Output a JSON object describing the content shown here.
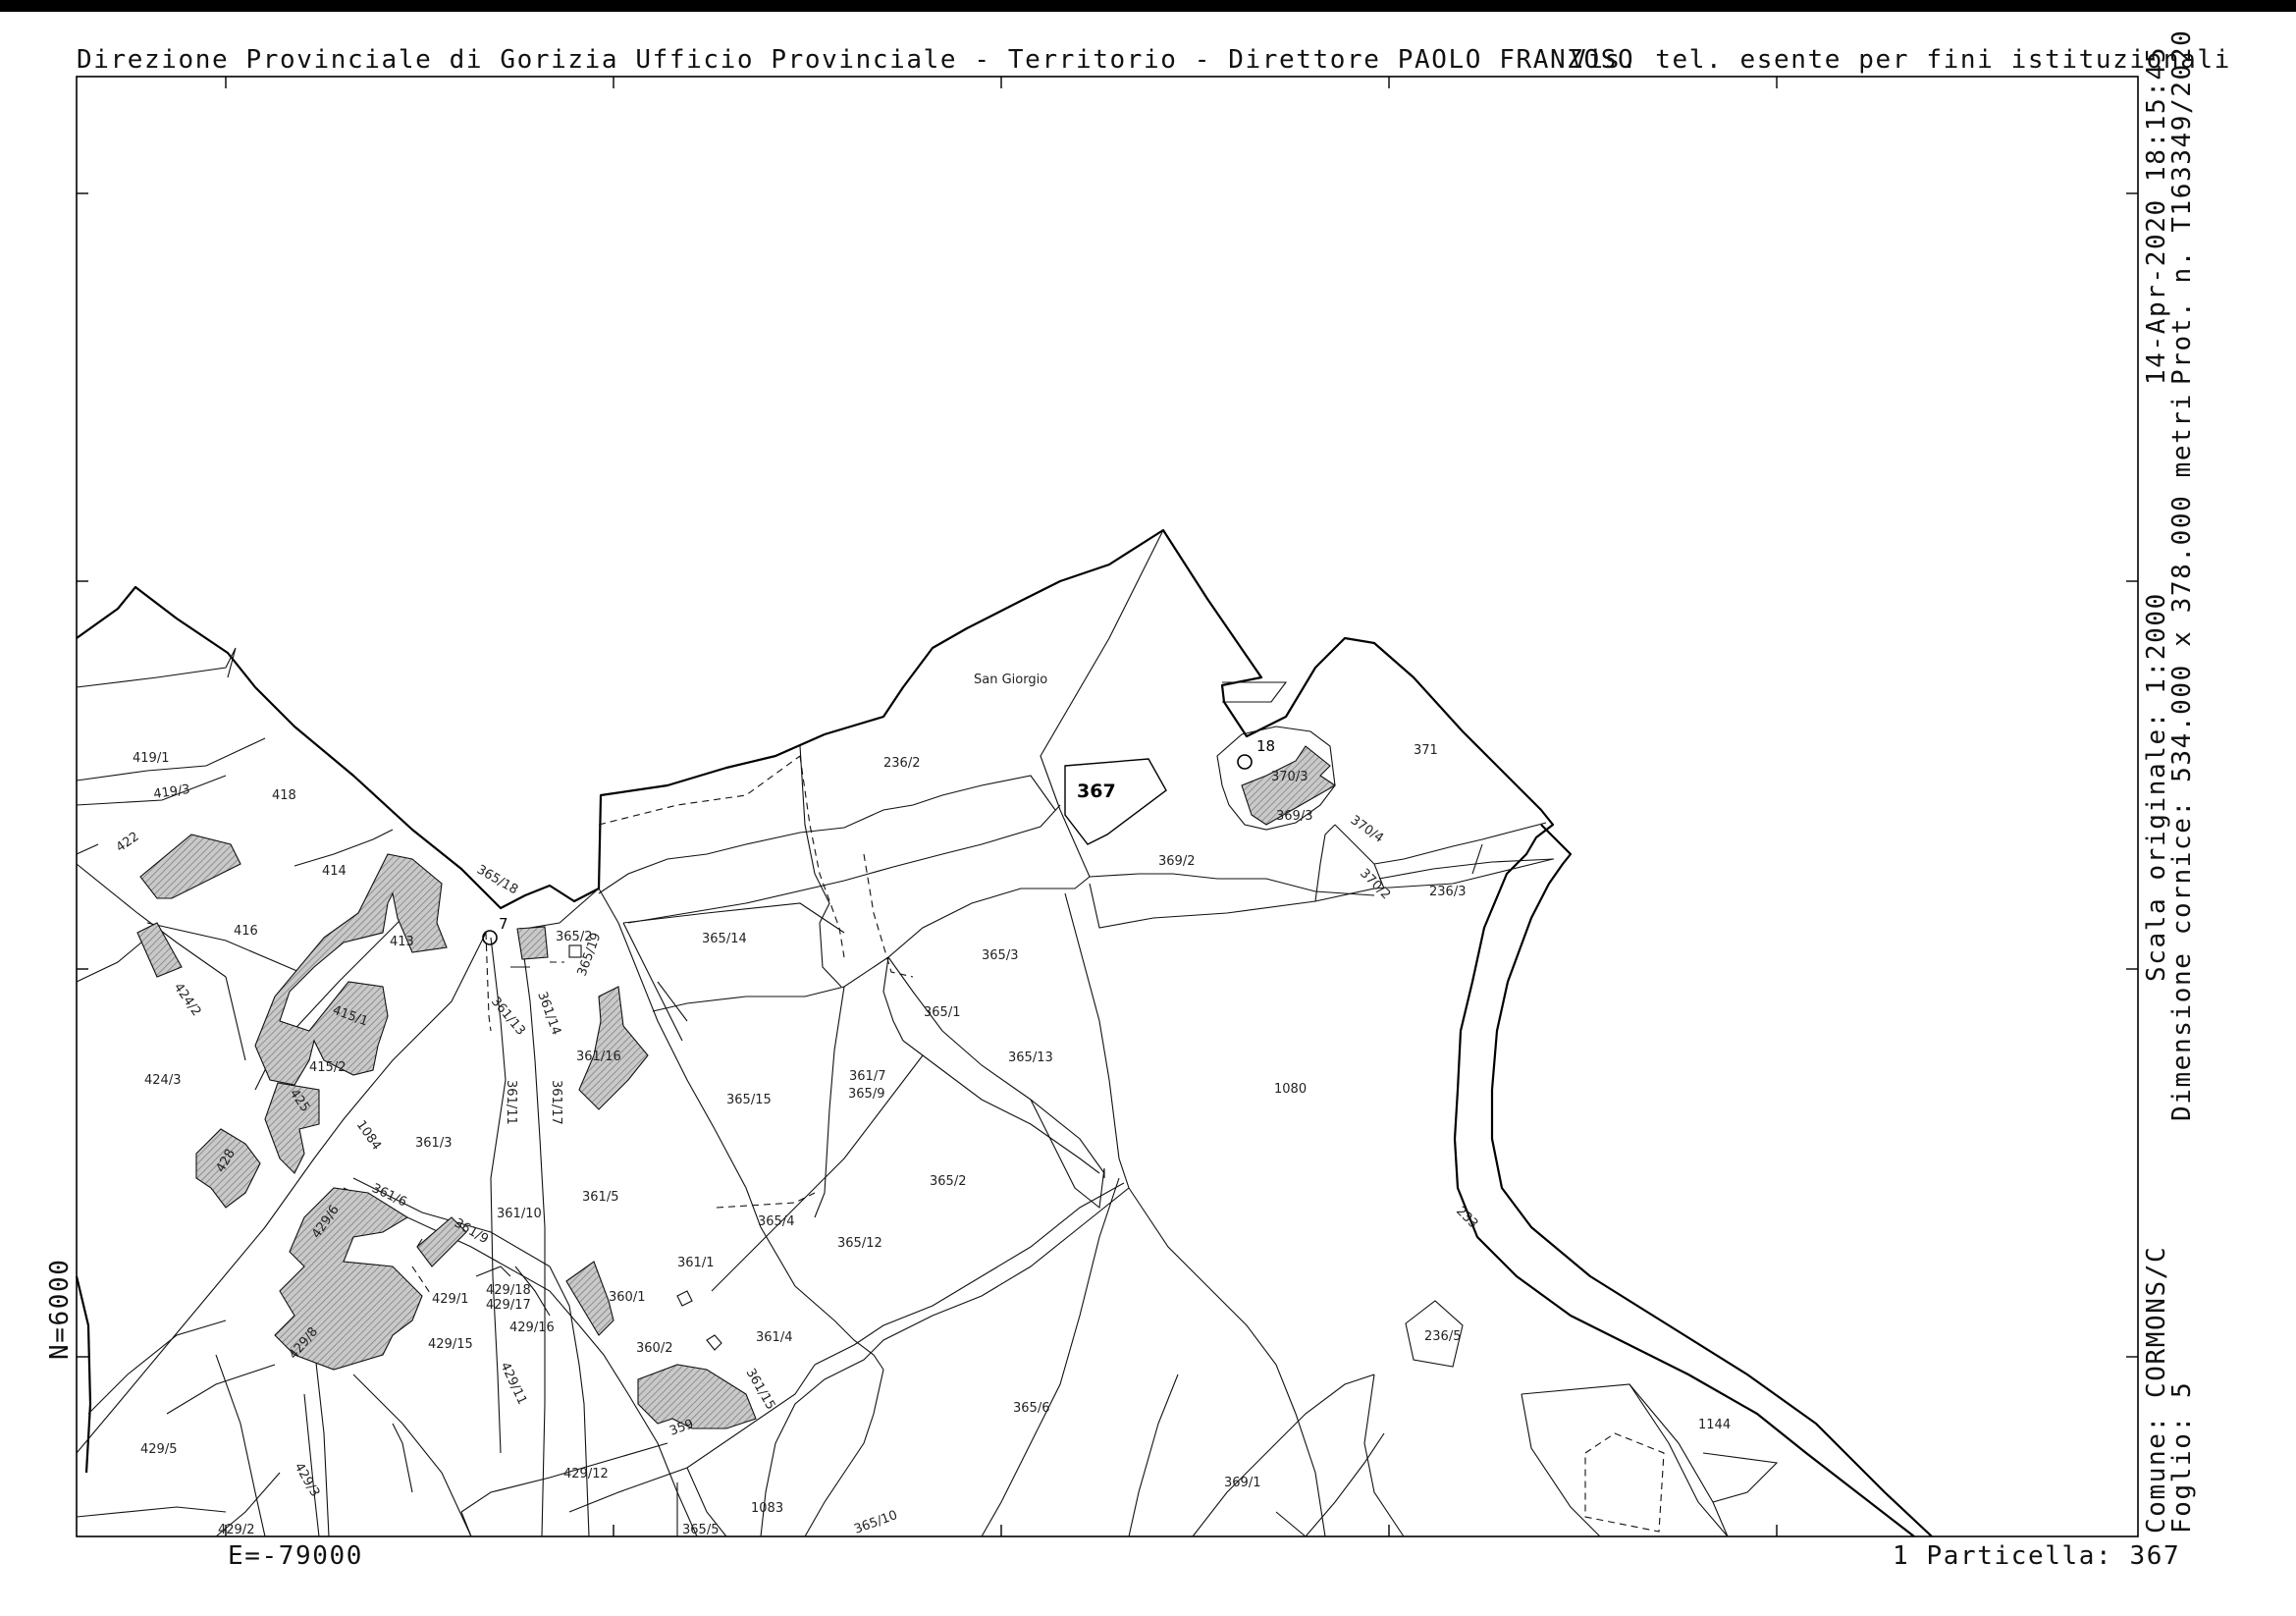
{
  "header": {
    "office": "Direzione Provinciale di Gorizia  Ufficio Provinciale - Territorio - Direttore PAOLO FRANZOSO",
    "note": "Vis. tel. esente per fini istituzionali"
  },
  "side": {
    "datetime": "14-Apr-2020 18:15:45",
    "protocol": "Prot. n. T163349/2020",
    "scale": "Scala originale: 1:2000",
    "frame": "Dimensione cornice: 534.000 x 378.000 metri",
    "comune": "Comune: CORMONS/C",
    "foglio": "Foglio: 5"
  },
  "axes": {
    "north": "N=6000",
    "east": "E=-79000"
  },
  "footer": {
    "particella": "1 Particella: 367"
  },
  "map": {
    "place_name": "San Giorgio",
    "selected_parcel": "367",
    "points": [
      "7",
      "18"
    ],
    "parcels": [
      "419/1",
      "419/3",
      "422",
      "418",
      "414",
      "416",
      "413",
      "424/2",
      "415/1",
      "424/3",
      "415/2",
      "425",
      "428",
      "1084",
      "361/3",
      "361/6",
      "361/9",
      "429/6",
      "429/1",
      "429/18",
      "429/17",
      "429/16",
      "429/15",
      "429/8",
      "429/11",
      "429/5",
      "429/3",
      "429/2",
      "429/12",
      "365/18",
      "365/2",
      "365/19",
      "361/14",
      "361/13",
      "361/16",
      "361/11",
      "361/17",
      "361/10",
      "361/5",
      "360/1",
      "360/2",
      "361/1",
      "361/4",
      "361/15",
      "359",
      "361/7",
      "1083",
      "365/5",
      "365/10",
      "365/14",
      "365/15",
      "365/9",
      "365/1",
      "236/2",
      "365/3",
      "365/13",
      "365/2",
      "365/4",
      "365/12",
      "365/6",
      "369/1",
      "369/2",
      "369/3",
      "370/3",
      "370/4",
      "370/2",
      "371",
      "236/3",
      "1080",
      "233",
      "236/5",
      "1144"
    ]
  }
}
